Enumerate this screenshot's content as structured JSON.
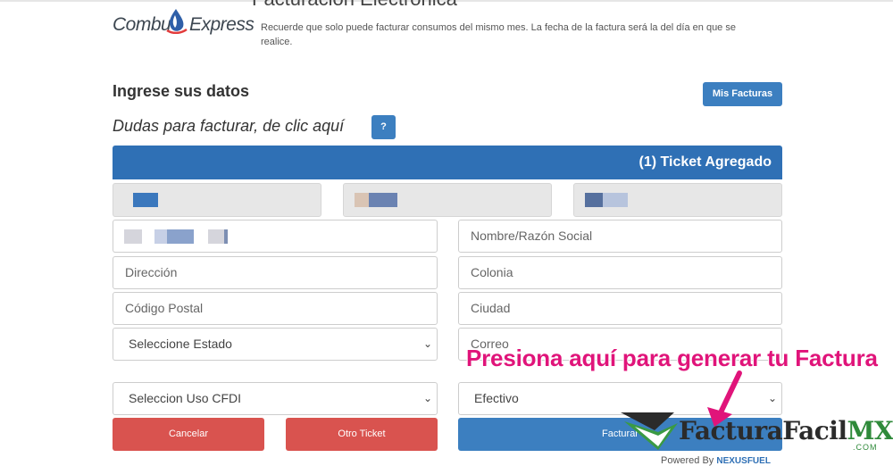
{
  "header": {
    "logo_left": "Combu",
    "logo_right": "Express",
    "title": "Facturación Electrónica",
    "notice": "Recuerde que solo puede facturar consumos del mismo mes. La fecha de la factura será la del día en que se realice."
  },
  "form": {
    "section_title": "Ingrese sus datos",
    "help_text": "Dudas para facturar, de clic aquí",
    "help_button": "?",
    "mis_facturas_button": "Mis Facturas",
    "ticket_bar": "(1) Ticket Agregado",
    "fields": {
      "nombre": "Nombre/Razón Social",
      "direccion": "Dirección",
      "colonia": "Colonia",
      "codigo_postal": "Código Postal",
      "ciudad": "Ciudad",
      "estado": "Seleccione Estado",
      "correo": "Correo",
      "uso_cfdi": "Seleccion Uso CFDI",
      "forma_pago": "Efectivo"
    },
    "buttons": {
      "cancelar": "Cancelar",
      "otro_ticket": "Otro Ticket",
      "facturar": "Facturar"
    },
    "powered_by": "Powered By",
    "powered_brand": "NEXUSFUEL"
  },
  "annotation": {
    "text": "Presiona aquí para generar tu Factura",
    "color": "#e0147a"
  },
  "watermark": {
    "name": "FacturaFacil",
    "suffix": "MX",
    "domain": ".COM"
  },
  "colors": {
    "primary_blue": "#2f70b5",
    "button_blue": "#3c7fc0",
    "danger_red": "#d9534f"
  }
}
